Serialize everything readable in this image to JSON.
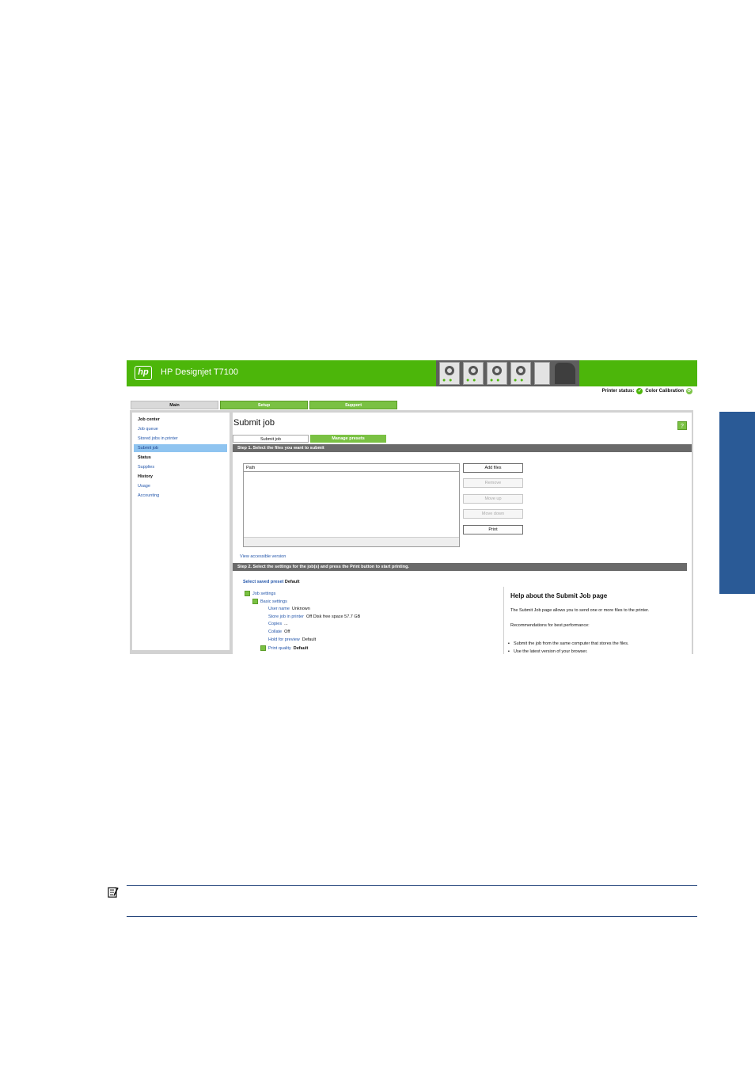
{
  "banner": {
    "logo": "hp",
    "product": "HP Designjet T7100"
  },
  "status": {
    "printer_status_label": "Printer status:",
    "printer_status_icon": "check-circle-icon",
    "color_calibration_label": "Color Calibration",
    "color_calibration_icon": "refresh-icon"
  },
  "main_tabs": [
    "Main",
    "Setup",
    "Support"
  ],
  "nav": {
    "items": [
      {
        "label": "Job center",
        "type": "heading"
      },
      {
        "label": "Job queue",
        "type": "link"
      },
      {
        "label": "Stored jobs in printer",
        "type": "link"
      },
      {
        "label": "Submit job",
        "type": "selected"
      },
      {
        "label": "Status",
        "type": "heading"
      },
      {
        "label": "Supplies",
        "type": "link"
      },
      {
        "label": "History",
        "type": "heading"
      },
      {
        "label": "Usage",
        "type": "link"
      },
      {
        "label": "Accounting",
        "type": "link"
      }
    ]
  },
  "page": {
    "title": "Submit job",
    "help_label": "?",
    "subtabs": [
      "Submit job",
      "Manage presets"
    ],
    "step1": "Step 1. Select the files you want to submit",
    "file_header": "Path",
    "buttons": {
      "add_files": "Add files",
      "remove": "Remove",
      "move_up": "Move up",
      "move_down": "Move down",
      "print": "Print"
    },
    "accessible_link": "View accessible version",
    "step2": "Step 2. Select the settings for the job(s) and press the Print button to start printing.",
    "preset_label": "Select saved preset",
    "preset_value": "Default"
  },
  "tree": {
    "job_settings": "Job settings",
    "basic_settings": "Basic settings",
    "user_name_label": "User name",
    "user_name_value": "Unknown",
    "store_label": "Store job in printer",
    "store_value": "Off Disk free space 57.7 GB",
    "copies_label": "Copies",
    "copies_value": "...",
    "collate_label": "Collate",
    "collate_value": "Off",
    "hold_label": "Hold for preview",
    "hold_value": "Default",
    "quality_label": "Print quality",
    "quality_value": "Default"
  },
  "help": {
    "title": "Help about the Submit Job page",
    "text": "The Submit Job page allows you to send one or more files to the printer.",
    "recommend": "Recommendations for best performance:",
    "bullets": [
      "Submit the job from the same computer that stores the files.",
      "Use the latest version of your browser."
    ]
  },
  "colors": {
    "banner_green": "#4cb60a",
    "tab_green": "#7ac143",
    "step_bar": "#6a6a6a",
    "side_tab_blue": "#2a5a96",
    "link_blue": "#2255aa"
  },
  "note_icon": "note-icon"
}
